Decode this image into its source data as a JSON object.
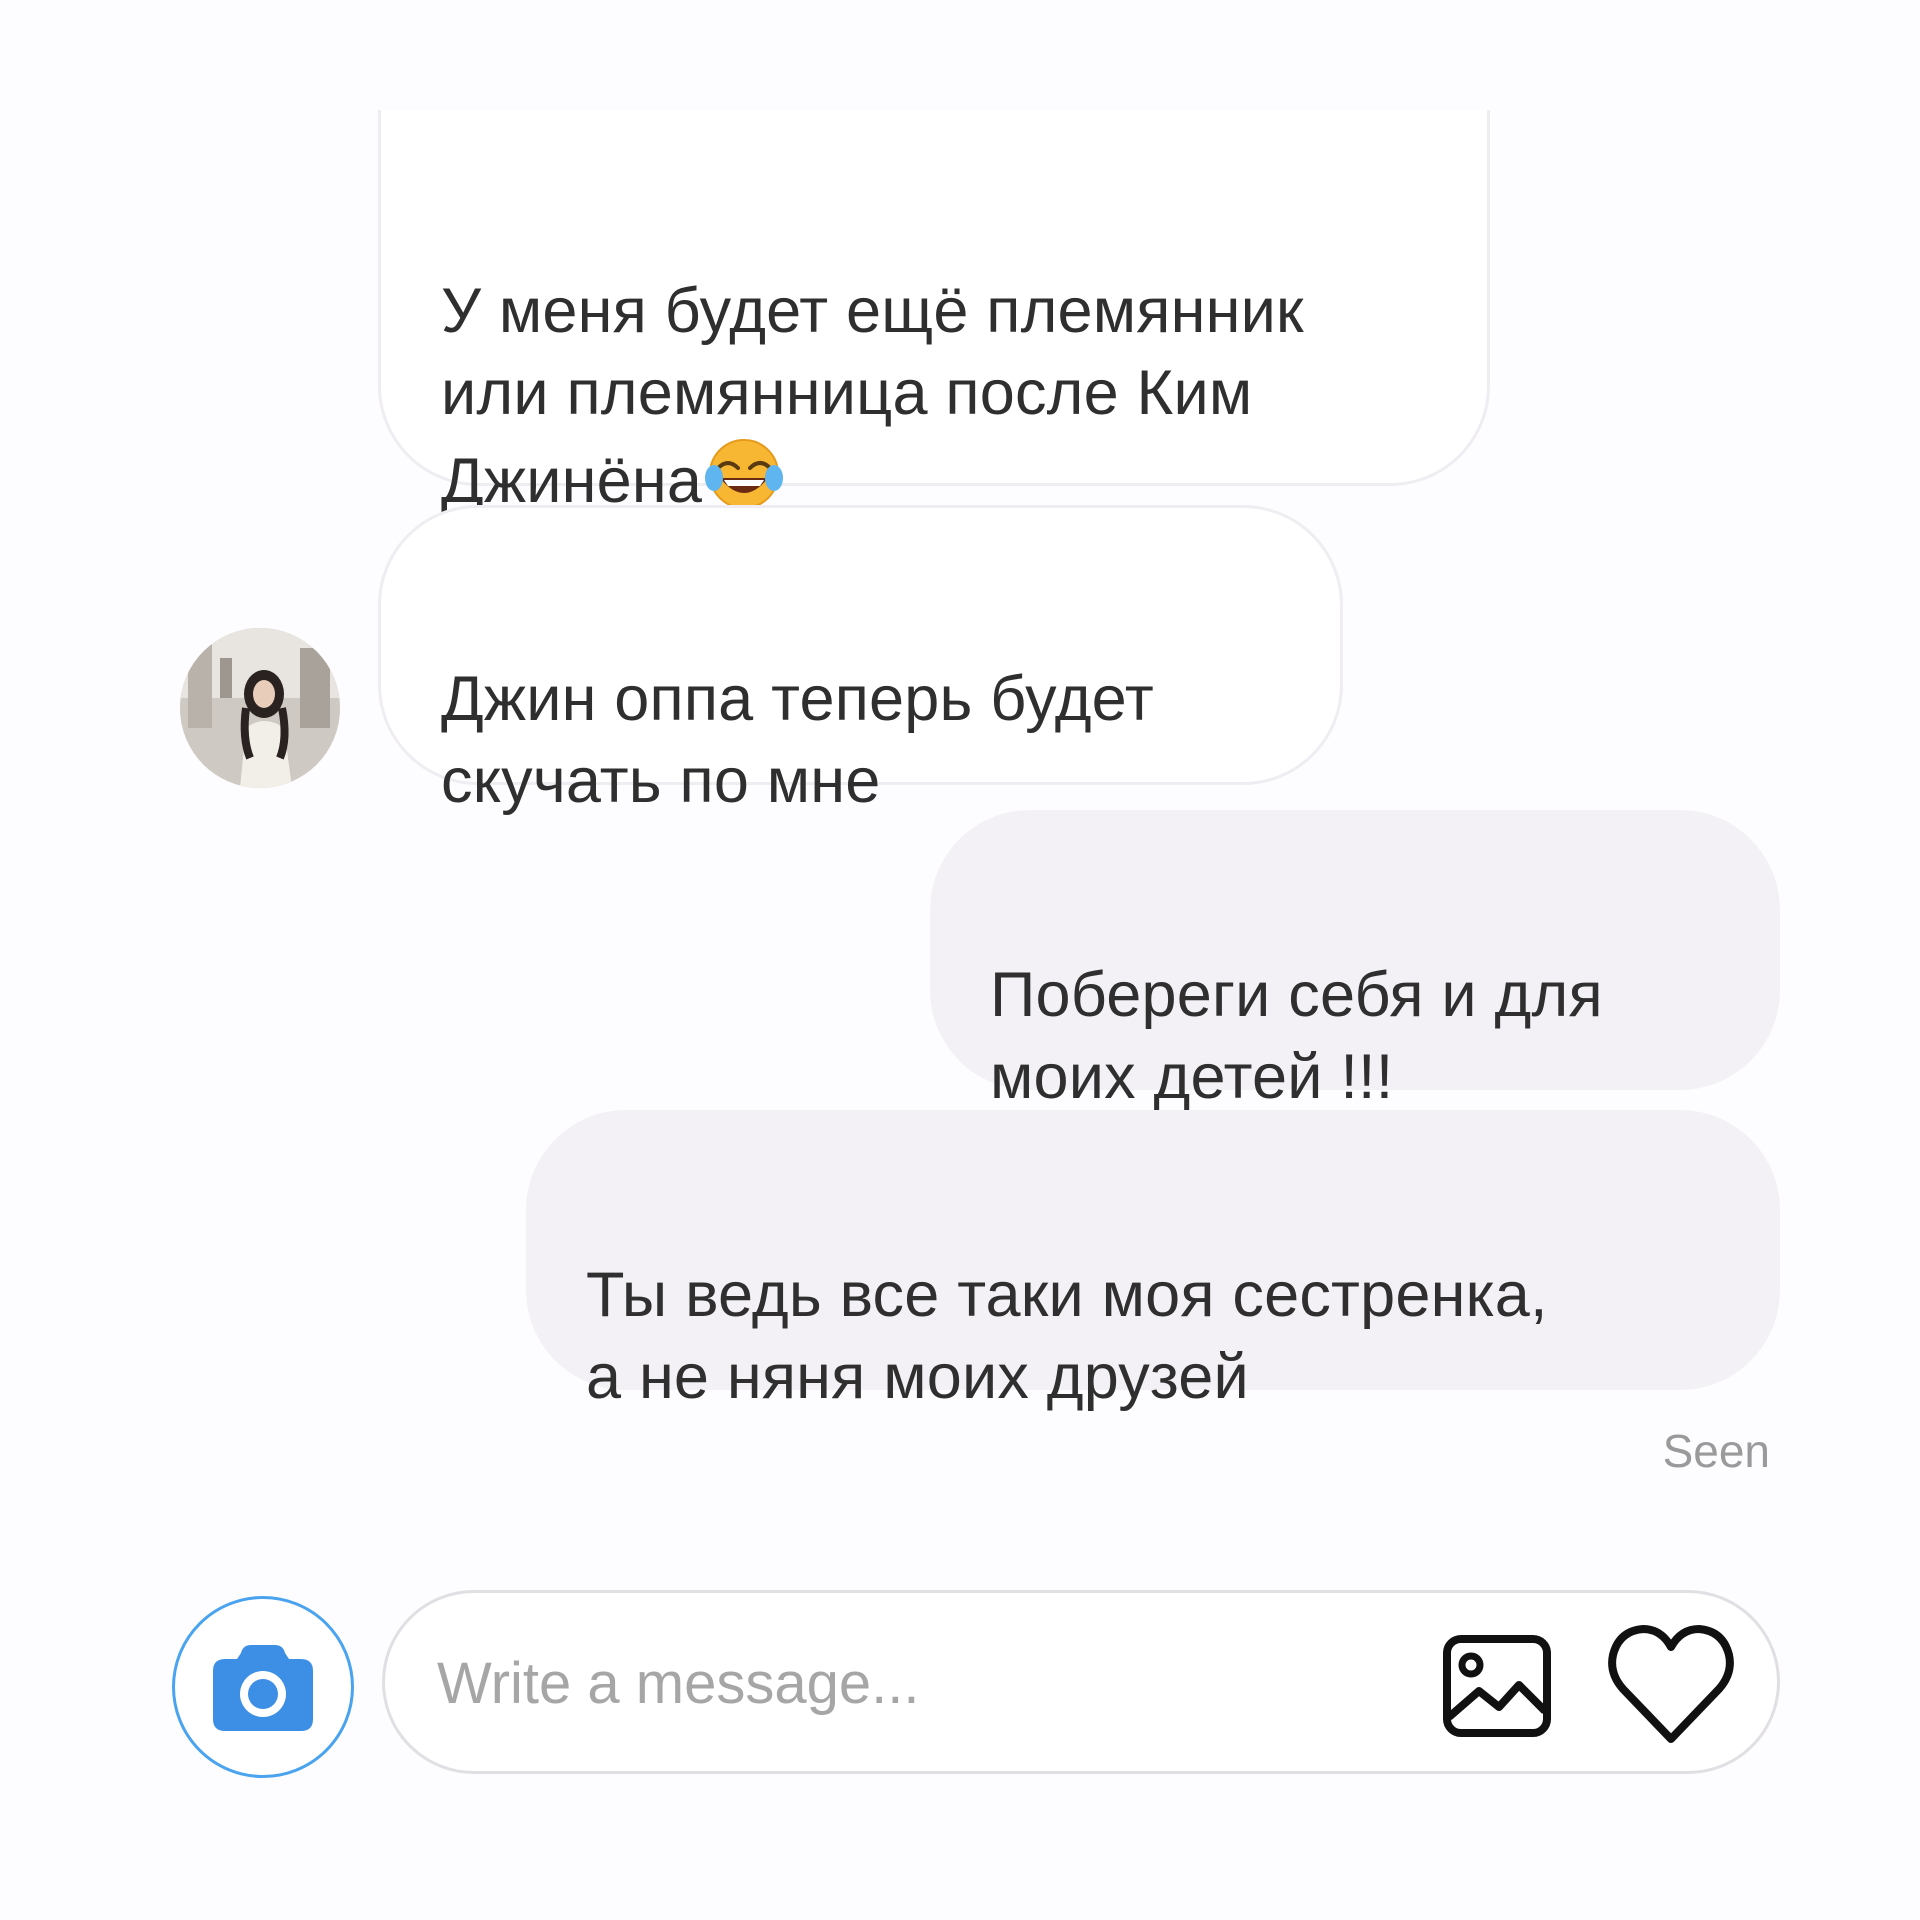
{
  "messages": [
    {
      "direction": "incoming",
      "text": "У меня будет ещё племянник\nили племянница после Ким\nДжинёна",
      "emoji": "face-with-tears-of-joy"
    },
    {
      "direction": "incoming",
      "text": "Джин оппа теперь будет\nскучать по мне",
      "avatar": "sender-avatar"
    },
    {
      "direction": "outgoing",
      "text": "Побереги себя и для\nмоих детей !!!"
    },
    {
      "direction": "outgoing",
      "text": "Ты ведь все таки моя сестренка,\nа не няня моих друзей"
    }
  ],
  "status": {
    "seen": "Seen"
  },
  "composer": {
    "placeholder": "Write a message...",
    "camera_icon": "camera-icon",
    "gallery_icon": "gallery-icon",
    "like_icon": "heart-icon"
  },
  "colors": {
    "background": "#fdfcfe",
    "outgoing_bubble": "#f3f1f5",
    "incoming_border": "#efedf2",
    "camera_blue": "#3d8fe6",
    "seen_text": "#9a9a9a"
  }
}
